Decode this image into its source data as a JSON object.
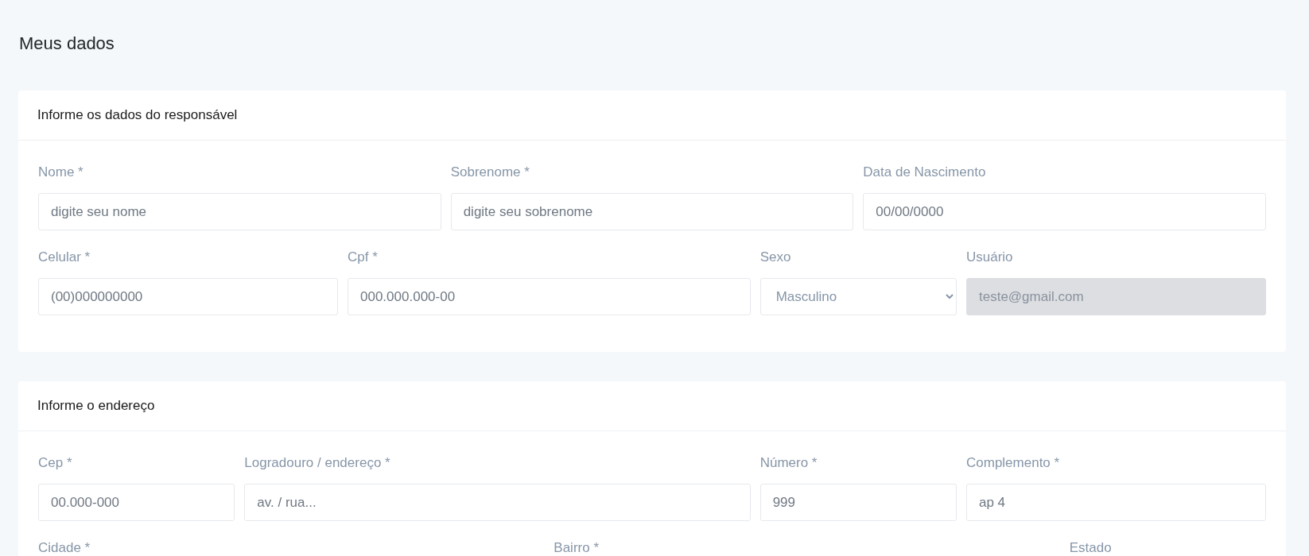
{
  "page_title": "Meus dados",
  "sections": [
    {
      "title": "Informe os dados do responsável",
      "rows": [
        [
          {
            "label": "Nome *",
            "kind": "input",
            "placeholder": "digite seu nome"
          },
          {
            "label": "Sobrenome *",
            "kind": "input",
            "placeholder": "digite seu sobrenome"
          },
          {
            "label": "Data de Nascimento",
            "kind": "input",
            "placeholder": "00/00/0000"
          }
        ],
        [
          {
            "label": "Celular *",
            "kind": "input",
            "placeholder": "(00)000000000"
          },
          {
            "label": "Cpf *",
            "kind": "input",
            "placeholder": "000.000.000-00"
          },
          {
            "label": "Sexo",
            "kind": "select",
            "value": "Masculino"
          },
          {
            "label": "Usuário",
            "kind": "input",
            "value": "teste@gmail.com",
            "disabled": true
          }
        ]
      ]
    },
    {
      "title": "Informe o endereço",
      "rows": [
        [
          {
            "label": "Cep *",
            "kind": "input",
            "placeholder": "00.000-000"
          },
          {
            "label": "Logradouro / endereço *",
            "kind": "input",
            "placeholder": "av. / rua..."
          },
          {
            "label": "Número *",
            "kind": "input",
            "placeholder": "999"
          },
          {
            "label": "Complemento *",
            "kind": "input",
            "placeholder": "ap 4"
          }
        ],
        [
          {
            "label": "Cidade *",
            "kind": "label"
          },
          {
            "label": "Bairro *",
            "kind": "label"
          },
          {
            "label": "Estado",
            "kind": "label"
          }
        ]
      ]
    }
  ]
}
